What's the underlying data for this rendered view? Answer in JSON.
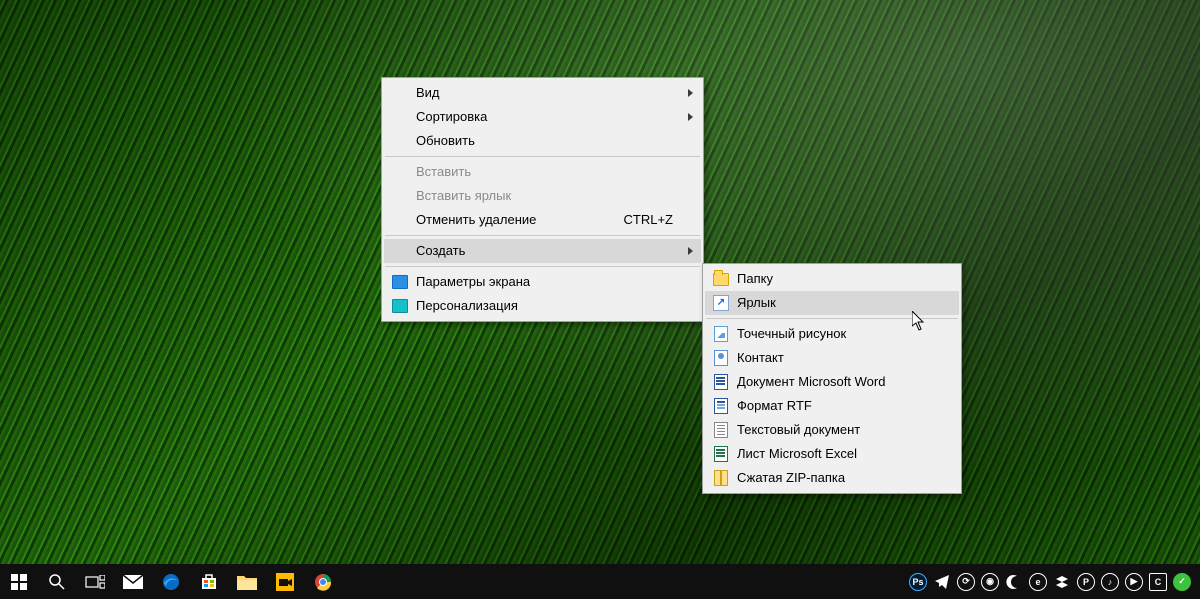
{
  "context_menu": {
    "items": [
      {
        "label": "Вид",
        "submenu": true
      },
      {
        "label": "Сортировка",
        "submenu": true
      },
      {
        "label": "Обновить"
      }
    ],
    "items2": [
      {
        "label": "Вставить",
        "disabled": true
      },
      {
        "label": "Вставить ярлык",
        "disabled": true
      },
      {
        "label": "Отменить удаление",
        "shortcut": "CTRL+Z"
      }
    ],
    "items3": [
      {
        "label": "Создать",
        "submenu": true,
        "hover": true
      }
    ],
    "items4": [
      {
        "label": "Параметры экрана",
        "icon": "display"
      },
      {
        "label": "Персонализация",
        "icon": "personalize"
      }
    ]
  },
  "submenu": {
    "items": [
      {
        "label": "Папку",
        "icon": "folder"
      },
      {
        "label": "Ярлык",
        "icon": "shortcut",
        "hover": true
      }
    ],
    "items2": [
      {
        "label": "Точечный рисунок",
        "icon": "bmp"
      },
      {
        "label": "Контакт",
        "icon": "contact"
      },
      {
        "label": "Документ Microsoft Word",
        "icon": "word"
      },
      {
        "label": "Формат RTF",
        "icon": "rtf"
      },
      {
        "label": "Текстовый документ",
        "icon": "txt"
      },
      {
        "label": "Лист Microsoft Excel",
        "icon": "excel"
      },
      {
        "label": "Сжатая ZIP-папка",
        "icon": "zip"
      }
    ]
  },
  "taskbar": {
    "left_icons": [
      "start",
      "search",
      "taskview",
      "mail",
      "edge",
      "store",
      "explorer",
      "video",
      "chrome"
    ],
    "tray_icons": [
      "ps",
      "telegram",
      "update",
      "chrome-o",
      "moon",
      "eset",
      "stack",
      "p",
      "volume",
      "play",
      "c",
      "green"
    ]
  }
}
